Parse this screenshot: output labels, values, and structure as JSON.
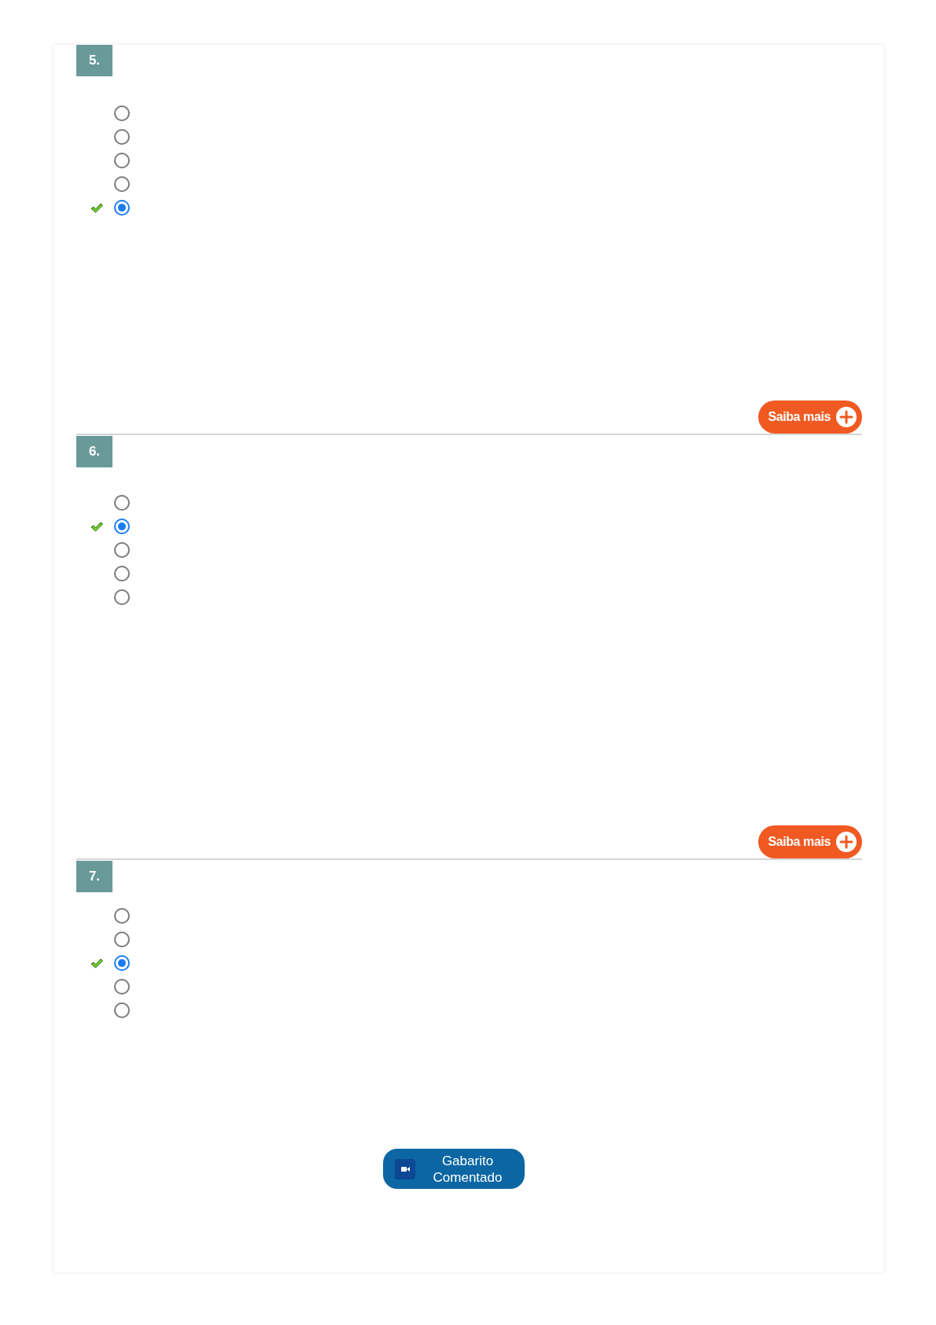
{
  "questions": [
    {
      "number": "5.",
      "options": [
        {
          "selected": false,
          "correct": false
        },
        {
          "selected": false,
          "correct": false
        },
        {
          "selected": false,
          "correct": false
        },
        {
          "selected": false,
          "correct": false
        },
        {
          "selected": true,
          "correct": true
        }
      ],
      "more_button": "Saiba mais"
    },
    {
      "number": "6.",
      "options": [
        {
          "selected": false,
          "correct": false
        },
        {
          "selected": true,
          "correct": true
        },
        {
          "selected": false,
          "correct": false
        },
        {
          "selected": false,
          "correct": false
        },
        {
          "selected": false,
          "correct": false
        }
      ],
      "more_button": "Saiba mais"
    },
    {
      "number": "7.",
      "options": [
        {
          "selected": false,
          "correct": false
        },
        {
          "selected": false,
          "correct": false
        },
        {
          "selected": true,
          "correct": true
        },
        {
          "selected": false,
          "correct": false
        },
        {
          "selected": false,
          "correct": false
        }
      ]
    }
  ],
  "answer_key_button": "Gabarito Comentado"
}
